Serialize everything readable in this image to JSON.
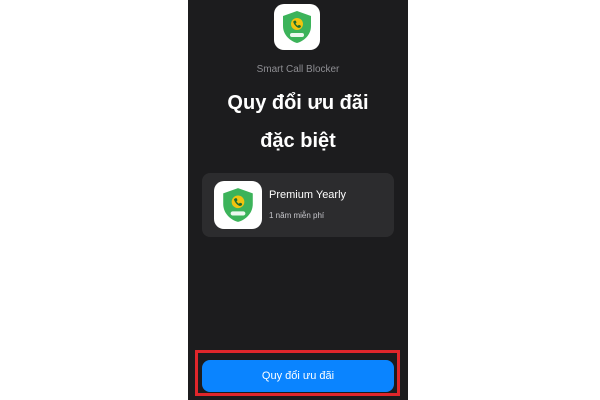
{
  "app": {
    "name": "Smart Call Blocker",
    "icon": "shield-phone-icon",
    "icon_colors": {
      "shield": "#3cb35a",
      "phone": "#f1c40f",
      "badge": "#ffffff"
    }
  },
  "headline": {
    "line1": "Quy đổi ưu đãi",
    "line2": "đặc biệt"
  },
  "offer": {
    "title": "Premium Yearly",
    "subtitle": "1 năm miễn phí",
    "icon": "shield-phone-icon"
  },
  "cta": {
    "label": "Quy đổi ưu đãi",
    "accent": "#0a84ff",
    "highlight_color": "#e0262b"
  },
  "theme": {
    "background": "#1c1c1e",
    "card": "#2c2c2e"
  }
}
